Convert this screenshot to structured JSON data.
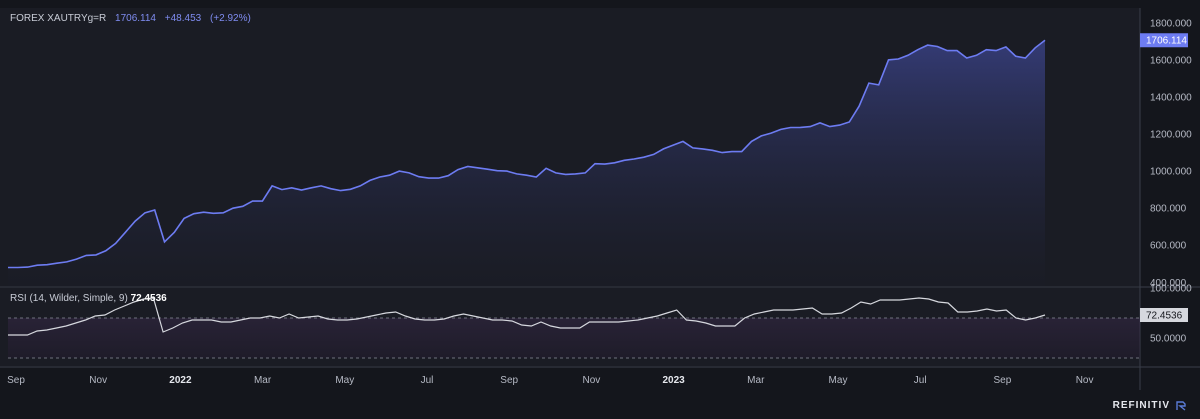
{
  "header": {
    "symbol": "FOREX XAUTRYg=R",
    "last": "1706.114",
    "change": "+48.453",
    "change_pct": "(+2.92%)"
  },
  "rsi": {
    "label": "RSI (14, Wilder, Simple, 9)",
    "value": "72.4536"
  },
  "brand": "REFINITIV",
  "colors": {
    "price_line": "#6d7cf2",
    "rsi_line": "#d6d8de",
    "background": "#14161c",
    "price_badge": "#6d7cf2",
    "rsi_badge": "#d6d8de"
  },
  "chart_data": [
    {
      "type": "area",
      "series": [
        {
          "values": [
            480,
            480,
            482,
            492,
            495,
            503,
            510,
            525,
            545,
            548,
            570,
            610,
            670,
            730,
            775,
            790,
            618,
            670,
            745,
            770,
            778,
            772,
            775,
            800,
            810,
            838,
            838,
            920,
            900,
            910,
            898,
            910,
            920,
            905,
            895,
            902,
            920,
            950,
            968,
            978,
            1000,
            990,
            970,
            962,
            962,
            975,
            1008,
            1025,
            1018,
            1010,
            1002,
            1000,
            985,
            978,
            968,
            1015,
            990,
            982,
            985,
            990,
            1040,
            1038,
            1045,
            1058,
            1065,
            1075,
            1090,
            1120,
            1140,
            1160,
            1125,
            1120,
            1112,
            1100,
            1105,
            1105,
            1160,
            1190,
            1205,
            1225,
            1235,
            1236,
            1240,
            1260,
            1240,
            1248,
            1265,
            1350,
            1475,
            1465,
            1600,
            1605,
            1625,
            1655,
            1680,
            1672,
            1650,
            1650,
            1610,
            1625,
            1655,
            1650,
            1670,
            1620,
            1610,
            1665,
            1706
          ]
        }
      ],
      "last_label": "1706.114",
      "yticks": [
        "1800.000",
        "1600.000",
        "1400.000",
        "1200.000",
        "1000.000",
        "800.000",
        "600.000",
        "400.000"
      ],
      "ylim": [
        380,
        1880
      ]
    },
    {
      "type": "line",
      "series": [
        {
          "values": [
            53,
            53,
            53,
            57,
            58,
            60,
            62,
            65,
            68,
            72,
            73,
            78,
            82,
            86,
            89,
            90,
            56,
            60,
            65,
            68,
            68,
            68,
            66,
            66,
            68,
            70,
            70,
            72,
            70,
            74,
            70,
            71,
            72,
            69,
            68,
            68,
            69,
            71,
            73,
            75,
            76,
            72,
            69,
            68,
            68,
            69,
            72,
            74,
            72,
            70,
            68,
            68,
            67,
            63,
            62,
            66,
            62,
            60,
            60,
            60,
            66,
            66,
            66,
            66,
            67,
            68,
            70,
            72,
            75,
            78,
            68,
            67,
            65,
            62,
            62,
            62,
            70,
            74,
            76,
            78,
            78,
            78,
            79,
            80,
            74,
            74,
            75,
            80,
            86,
            84,
            88,
            88,
            88,
            89,
            90,
            89,
            86,
            85,
            76,
            76,
            77,
            79,
            77,
            78,
            70,
            68,
            70,
            73
          ]
        }
      ],
      "last_label": "72.4536",
      "yticks": [
        "100.0000",
        "50.0000"
      ],
      "ylim": [
        22,
        100
      ]
    }
  ],
  "x_axis": {
    "labels": [
      "Sep",
      "Nov",
      "2022",
      "Mar",
      "May",
      "Jul",
      "Sep",
      "Nov",
      "2023",
      "Mar",
      "May",
      "Jul",
      "Sep",
      "Nov"
    ]
  }
}
